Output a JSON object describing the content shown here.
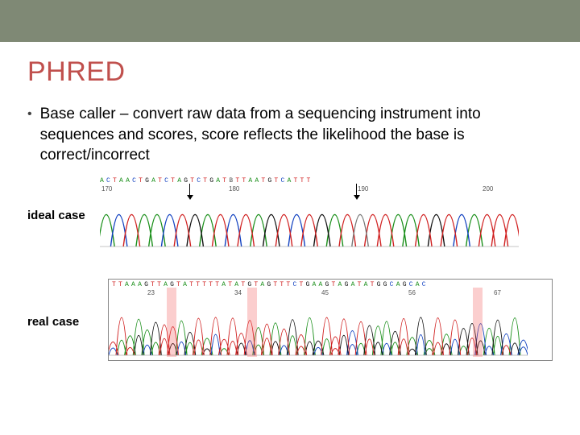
{
  "title": "PHRED",
  "bullet": "Base caller – convert raw data from a sequencing instrument into sequences and scores, score reflects the likelihood the base is correct/incorrect",
  "ideal": {
    "label": "ideal case",
    "positions": [
      "170",
      "180",
      "190",
      "200"
    ],
    "bases": [
      "A",
      "C",
      "T",
      "A",
      "A",
      "C",
      "T",
      "G",
      "A",
      "T",
      "C",
      "T",
      "A",
      "G",
      "T",
      "C",
      "T",
      "G",
      "A",
      "T",
      "B",
      "T",
      "T",
      "A",
      "A",
      "T",
      "G",
      "T",
      "C",
      "A",
      "T",
      "T",
      "T"
    ]
  },
  "real": {
    "label": "real case",
    "positions": [
      "23",
      "34",
      "45",
      "56",
      "67"
    ],
    "bases": [
      "T",
      "T",
      "A",
      "A",
      "A",
      "G",
      "T",
      "T",
      "A",
      "G",
      "T",
      "A",
      "T",
      "T",
      "T",
      "T",
      "T",
      "A",
      "T",
      "A",
      "T",
      "G",
      "T",
      "A",
      "G",
      "T",
      "T",
      "T",
      "C",
      "T",
      "G",
      "A",
      "A",
      "G",
      "T",
      "A",
      "G",
      "A",
      "T",
      "A",
      "T",
      "G",
      "G",
      "C",
      "A",
      "G",
      "C",
      "A",
      "C"
    ]
  }
}
